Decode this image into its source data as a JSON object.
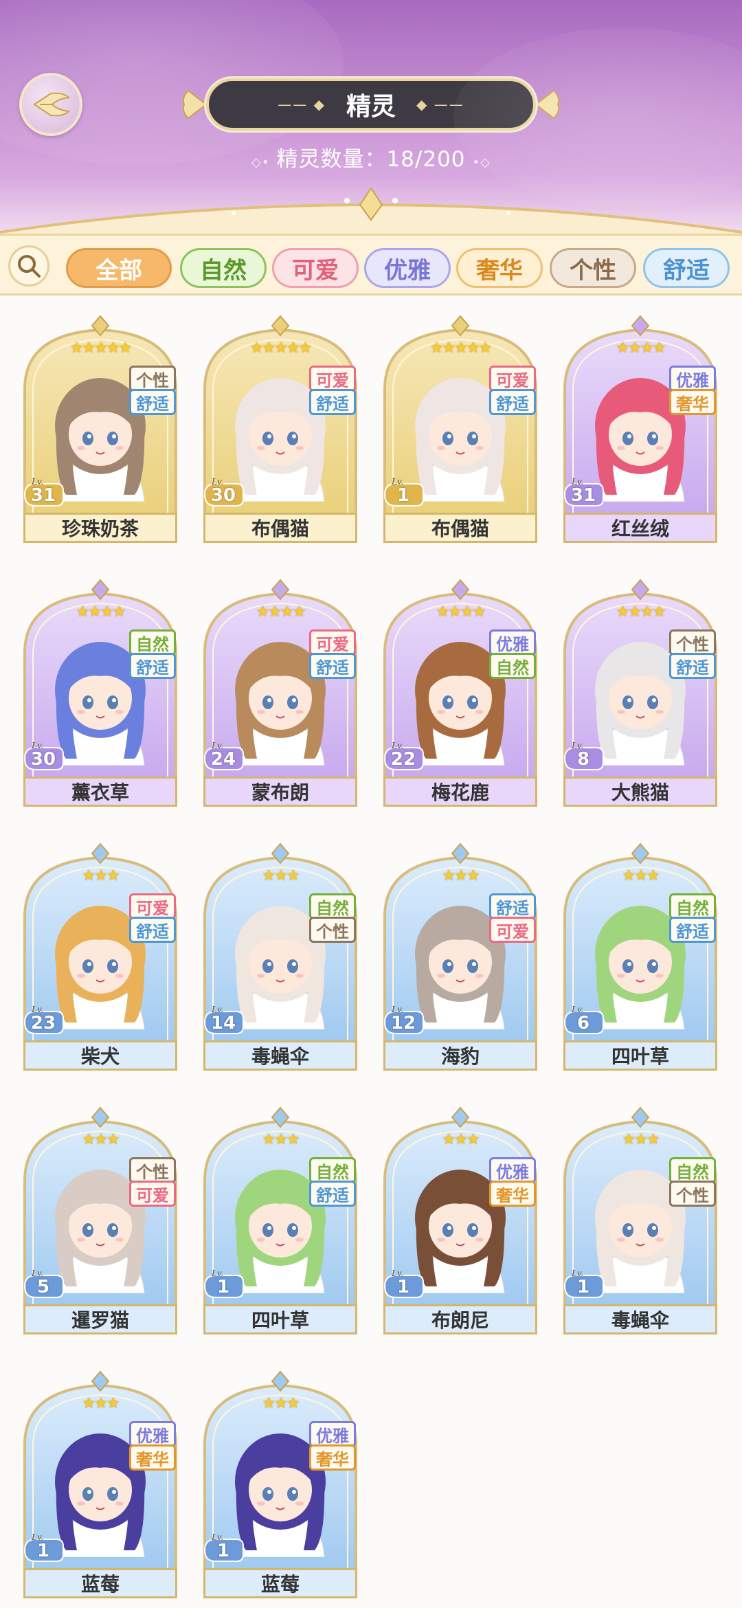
{
  "header": {
    "title": "精灵",
    "count_label": "精灵数量：",
    "count_value": "18/200"
  },
  "filter": {
    "tabs": [
      {
        "label": "全部",
        "selected": true
      },
      {
        "label": "自然",
        "selected": false
      },
      {
        "label": "可爱",
        "selected": false
      },
      {
        "label": "优雅",
        "selected": false
      },
      {
        "label": "奢华",
        "selected": false
      },
      {
        "label": "个性",
        "selected": false
      },
      {
        "label": "舒适",
        "selected": false
      }
    ]
  },
  "lv_text": "Lv.",
  "colors": {
    "自然": "#72b03a",
    "可爱": "#ea6a82",
    "优雅": "#7b7be0",
    "奢华": "#e2972d",
    "个性": "#8b7560",
    "舒适": "#4d97d6",
    "rarity5_bg": "#f4e2b0",
    "rarity4_bg": "#dcc8f3",
    "rarity3_bg": "#c6dff6"
  },
  "spirits": [
    {
      "name": "珍珠奶茶",
      "level": "31",
      "stars": "★★★★★",
      "rarity": 5,
      "tags": [
        "个性",
        "舒适"
      ],
      "hair": "#a08670"
    },
    {
      "name": "布偶猫",
      "level": "30",
      "stars": "★★★★★",
      "rarity": 5,
      "tags": [
        "可爱",
        "舒适"
      ],
      "hair": "#efe6e4"
    },
    {
      "name": "布偶猫",
      "level": "1",
      "stars": "★★★★★",
      "rarity": 5,
      "tags": [
        "可爱",
        "舒适"
      ],
      "hair": "#efe6e4"
    },
    {
      "name": "红丝绒",
      "level": "31",
      "stars": "★★★★",
      "rarity": 4,
      "tags": [
        "优雅",
        "奢华"
      ],
      "hair": "#e75a7a"
    },
    {
      "name": "薰衣草",
      "level": "30",
      "stars": "★★★★",
      "rarity": 4,
      "tags": [
        "自然",
        "舒适"
      ],
      "hair": "#6a7fde"
    },
    {
      "name": "蒙布朗",
      "level": "24",
      "stars": "★★★★",
      "rarity": 4,
      "tags": [
        "可爱",
        "舒适"
      ],
      "hair": "#b98b5c"
    },
    {
      "name": "梅花鹿",
      "level": "22",
      "stars": "★★★★",
      "rarity": 4,
      "tags": [
        "优雅",
        "自然"
      ],
      "hair": "#a86b40"
    },
    {
      "name": "大熊猫",
      "level": "8",
      "stars": "★★★★",
      "rarity": 4,
      "tags": [
        "个性",
        "舒适"
      ],
      "hair": "#e8e6e6"
    },
    {
      "name": "柴犬",
      "level": "23",
      "stars": "★★★",
      "rarity": 3,
      "tags": [
        "可爱",
        "舒适"
      ],
      "hair": "#e9b25a"
    },
    {
      "name": "毒蝇伞",
      "level": "14",
      "stars": "★★★",
      "rarity": 3,
      "tags": [
        "自然",
        "个性"
      ],
      "hair": "#f0e6e0"
    },
    {
      "name": "海豹",
      "level": "12",
      "stars": "★★★",
      "rarity": 3,
      "tags": [
        "舒适",
        "可爱"
      ],
      "hair": "#b8aaa0"
    },
    {
      "name": "四叶草",
      "level": "6",
      "stars": "★★★",
      "rarity": 3,
      "tags": [
        "自然",
        "舒适"
      ],
      "hair": "#9fd67d"
    },
    {
      "name": "暹罗猫",
      "level": "5",
      "stars": "★★★",
      "rarity": 3,
      "tags": [
        "个性",
        "可爱"
      ],
      "hair": "#d8ccc4"
    },
    {
      "name": "四叶草",
      "level": "1",
      "stars": "★★★",
      "rarity": 3,
      "tags": [
        "自然",
        "舒适"
      ],
      "hair": "#9fd67d"
    },
    {
      "name": "布朗尼",
      "level": "1",
      "stars": "★★★",
      "rarity": 3,
      "tags": [
        "优雅",
        "奢华"
      ],
      "hair": "#7a4f38"
    },
    {
      "name": "毒蝇伞",
      "level": "1",
      "stars": "★★★",
      "rarity": 3,
      "tags": [
        "自然",
        "个性"
      ],
      "hair": "#f0e6e0"
    },
    {
      "name": "蓝莓",
      "level": "1",
      "stars": "★★★",
      "rarity": 3,
      "tags": [
        "优雅",
        "奢华"
      ],
      "hair": "#4a3e9e"
    },
    {
      "name": "蓝莓",
      "level": "1",
      "stars": "★★★",
      "rarity": 3,
      "tags": [
        "优雅",
        "奢华"
      ],
      "hair": "#4a3e9e"
    }
  ]
}
